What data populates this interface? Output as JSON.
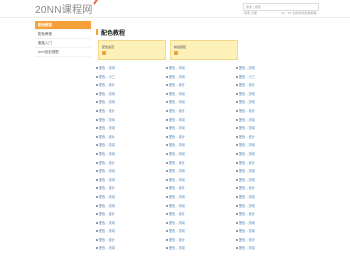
{
  "header": {
    "logo": "20NN课程网",
    "search_placeholder": "搜索 | 搜索",
    "meta_left": "搜索  引擎",
    "meta_right": "24 · 42   如何学好配色教程"
  },
  "sidebar": {
    "items": [
      {
        "label": "配色教程",
        "active": true
      },
      {
        "label": "配色教程",
        "active": false
      },
      {
        "label": "服装入门",
        "active": false
      },
      {
        "label": "mm色彩搭配",
        "active": false
      }
    ]
  },
  "main": {
    "title": "配色教程",
    "cards": [
      {
        "label": "配色速查"
      },
      {
        "label": "精选搭配"
      }
    ],
    "columns": [
      [
        "配色 - 流动",
        "配色 - 小三",
        "配色 - 设计",
        "配色 - 流动",
        "配色 - 流动",
        "配色 - 设计",
        "配色 - 流动",
        "配色 - 流动",
        "配色 - 设计",
        "配色 - 流动",
        "配色 - 流动",
        "配色 - 设计",
        "配色 - 流动",
        "配色 - 流动",
        "配色 - 设计",
        "配色 - 流动",
        "配色 - 流动",
        "配色 - 设计",
        "配色 - 流动",
        "配色 - 流动",
        "配色 - 设计",
        "配色 - 流动"
      ],
      [
        "配色 - 流动",
        "配色 - 流动",
        "配色 - 设计",
        "配色 - 流动",
        "配色 - 流动",
        "配色 - 设计",
        "配色 - 流动",
        "配色 - 流动",
        "配色 - 设计",
        "配色 - 流动",
        "配色 - 流动",
        "配色 - 设计",
        "配色 - 流动",
        "配色 - 流动",
        "配色 - 设计",
        "配色 - 流动",
        "配色 - 流动",
        "配色 - 设计",
        "配色 - 流动",
        "配色 - 流动",
        "配色 - 设计",
        "配色 - 流动"
      ],
      [
        "配色 - 流动",
        "配色 - 小三",
        "配色 - 设计",
        "配色 - 流动",
        "配色 - 流动",
        "配色 - 设计",
        "配色 - 流动",
        "配色 - 流动",
        "配色 - 设计",
        "配色 - 流动",
        "配色 - 流动",
        "配色 - 设计",
        "配色 - 流动",
        "配色 - 流动",
        "配色 - 设计",
        "配色 - 流动",
        "配色 - 流动",
        "配色 - 设计",
        "配色 - 流动",
        "配色 - 流动",
        "配色 - 设计",
        "配色 - 流动"
      ]
    ]
  },
  "colors": {
    "accent": "#f6a03c",
    "card_bg": "#fdf0b8",
    "link": "#4a7fb5"
  }
}
